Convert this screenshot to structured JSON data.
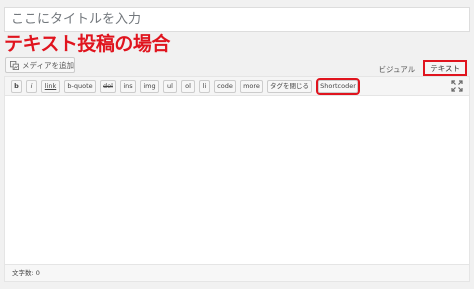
{
  "title_field": {
    "placeholder": "ここにタイトルを入力"
  },
  "annotation": {
    "text": "テキスト投稿の場合",
    "color": "#e0141e"
  },
  "media_button": {
    "label": "メディアを追加"
  },
  "editor_tabs": [
    {
      "label": "ビジュアル",
      "active": false
    },
    {
      "label": "テキスト",
      "active": true
    }
  ],
  "toolbar": {
    "buttons": [
      {
        "label": "b"
      },
      {
        "label": "i"
      },
      {
        "label": "link"
      },
      {
        "label": "b-quote"
      },
      {
        "label": "del"
      },
      {
        "label": "ins"
      },
      {
        "label": "img"
      },
      {
        "label": "ul"
      },
      {
        "label": "ol"
      },
      {
        "label": "li"
      },
      {
        "label": "code"
      },
      {
        "label": "more"
      },
      {
        "label": "タグを閉じる"
      },
      {
        "label": "Shortcoder",
        "highlighted": true
      }
    ],
    "fullscreen_icon": "fullscreen-icon"
  },
  "status_bar": {
    "word_count": "文字数: 0"
  }
}
